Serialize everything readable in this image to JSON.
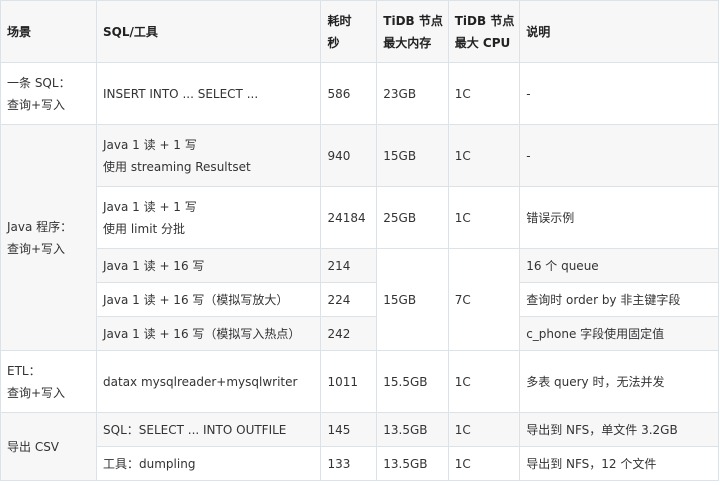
{
  "headers": {
    "scene": "场景",
    "sql": "SQL/工具",
    "time_1": "耗时",
    "time_2": "秒",
    "mem_1": "TiDB 节点",
    "mem_2": "最大内存",
    "cpu_1": "TiDB 节点",
    "cpu_2": "最大 CPU",
    "note": "说明"
  },
  "groups": {
    "g1": {
      "scene_1": "一条 SQL：",
      "scene_2": "查询+写入"
    },
    "g2": {
      "scene_1": "Java 程序：",
      "scene_2": "查询+写入"
    },
    "g3": {
      "scene_1": "ETL：",
      "scene_2": "查询+写入"
    },
    "g4": {
      "scene_1": "导出 CSV"
    }
  },
  "rows": [
    {
      "sql": "INSERT INTO ... SELECT ...",
      "time": "586",
      "mem": "23GB",
      "cpu": "1C",
      "note": "-"
    },
    {
      "sql_1": "Java 1 读 + 1 写",
      "sql_2": "使用 streaming Resultset",
      "time": "940",
      "mem": "15GB",
      "cpu": "1C",
      "note": "-"
    },
    {
      "sql_1": "Java 1 读 + 1 写",
      "sql_2": "使用 limit 分批",
      "time": "24184",
      "mem": "25GB",
      "cpu": "1C",
      "note": "错误示例"
    },
    {
      "sql": "Java 1 读 + 16 写",
      "time": "214",
      "mem": "15GB",
      "cpu": "7C",
      "note": "16 个 queue"
    },
    {
      "sql": "Java 1 读 + 16 写（模拟写放大）",
      "time": "224",
      "note": "查询时 order by 非主键字段"
    },
    {
      "sql": "Java 1 读 + 16 写（模拟写入热点）",
      "time": "242",
      "note": "c_phone 字段使用固定值"
    },
    {
      "sql": "datax mysqlreader+mysqlwriter",
      "time": "1011",
      "mem": "15.5GB",
      "cpu": "1C",
      "note": "多表 query 时，无法并发"
    },
    {
      "sql": "SQL：SELECT ... INTO OUTFILE",
      "time": "145",
      "mem": "13.5GB",
      "cpu": "1C",
      "note": "导出到 NFS，单文件 3.2GB"
    },
    {
      "sql": "工具：dumpling",
      "time": "133",
      "mem": "13.5GB",
      "cpu": "1C",
      "note": "导出到 NFS，12 个文件"
    }
  ]
}
